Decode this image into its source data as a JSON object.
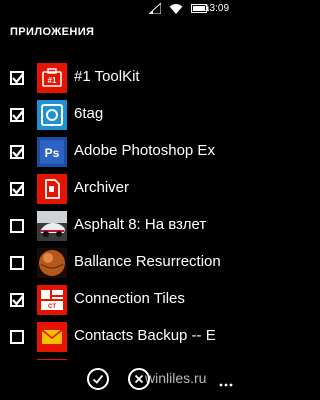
{
  "status_bar": {
    "time": "13:09",
    "icons": [
      "signal-icon",
      "wifi-icon",
      "battery-icon"
    ]
  },
  "header": {
    "title": "ПРИЛОЖЕНИЯ"
  },
  "apps": [
    {
      "name": "#1 ToolKit",
      "checked": true,
      "icon": "toolkit-icon"
    },
    {
      "name": "6tag",
      "checked": true,
      "icon": "6tag-icon"
    },
    {
      "name": "Adobe Photoshop Ex",
      "checked": true,
      "icon": "photoshop-express-icon"
    },
    {
      "name": "Archiver",
      "checked": true,
      "icon": "archiver-icon"
    },
    {
      "name": "Asphalt 8: На взлет",
      "checked": false,
      "icon": "asphalt-8-icon"
    },
    {
      "name": "Ballance Resurrection",
      "checked": false,
      "icon": "ballance-icon"
    },
    {
      "name": "Connection Tiles",
      "checked": true,
      "icon": "connection-tiles-icon"
    },
    {
      "name": "Contacts Backup -- E",
      "checked": false,
      "icon": "contacts-backup-icon"
    }
  ],
  "app_bar": {
    "buttons": [
      "check-icon",
      "close-icon"
    ],
    "more": "ellipsis-icon"
  },
  "watermark": "winliles.ru",
  "colors": {
    "background": "#000000",
    "foreground": "#ffffff",
    "tile_red": "#e51400",
    "tile_blue": "#1e91d6"
  }
}
